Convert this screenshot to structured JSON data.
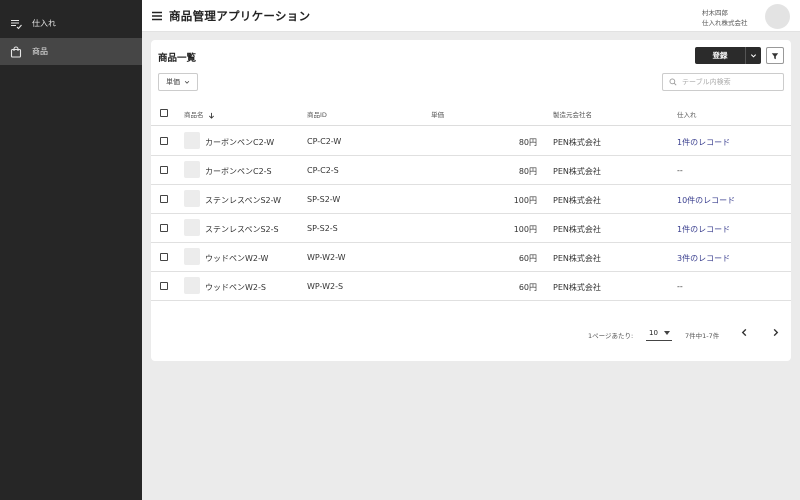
{
  "sidebar": {
    "items": [
      {
        "label": "仕入れ",
        "icon": "purchase-list-icon",
        "active": false
      },
      {
        "label": "商品",
        "icon": "shopping-bag-icon",
        "active": true
      }
    ]
  },
  "header": {
    "menu_icon": "hamburger-menu-icon",
    "title": "商品管理アプリケーション",
    "user_name": "村木四郎",
    "user_company": "仕入れ株式会社"
  },
  "card": {
    "title": "商品一覧",
    "register_label": "登録",
    "price_filter_label": "単価",
    "search_placeholder": "テーブル内検索"
  },
  "table": {
    "columns": {
      "name": "商品名",
      "id": "商品ID",
      "price": "単価",
      "maker": "製造元会社名",
      "purchase": "仕入れ"
    },
    "rows": [
      {
        "name": "カーボンペンC2-W",
        "id": "CP-C2-W",
        "price": "80円",
        "maker": "PEN株式会社",
        "purchase": "1件のレコード",
        "purchase_is_link": true
      },
      {
        "name": "カーボンペンC2-S",
        "id": "CP-C2-S",
        "price": "80円",
        "maker": "PEN株式会社",
        "purchase": "--",
        "purchase_is_link": false
      },
      {
        "name": "ステンレスペンS2-W",
        "id": "SP-S2-W",
        "price": "100円",
        "maker": "PEN株式会社",
        "purchase": "10件のレコード",
        "purchase_is_link": true
      },
      {
        "name": "ステンレスペンS2-S",
        "id": "SP-S2-S",
        "price": "100円",
        "maker": "PEN株式会社",
        "purchase": "1件のレコード",
        "purchase_is_link": true
      },
      {
        "name": "ウッドペンW2-W",
        "id": "WP-W2-W",
        "price": "60円",
        "maker": "PEN株式会社",
        "purchase": "3件のレコード",
        "purchase_is_link": true
      },
      {
        "name": "ウッドペンW2-S",
        "id": "WP-W2-S",
        "price": "60円",
        "maker": "PEN株式会社",
        "purchase": "--",
        "purchase_is_link": false
      }
    ]
  },
  "pagination": {
    "per_page_label": "1ページあたり:",
    "per_page_value": "10",
    "range_label": "7件中1-7件"
  },
  "colors": {
    "sidebar_bg": "#262626",
    "sidebar_active": "#464646",
    "link": "#3a3f8f",
    "primary_button": "#2b2b2b"
  }
}
